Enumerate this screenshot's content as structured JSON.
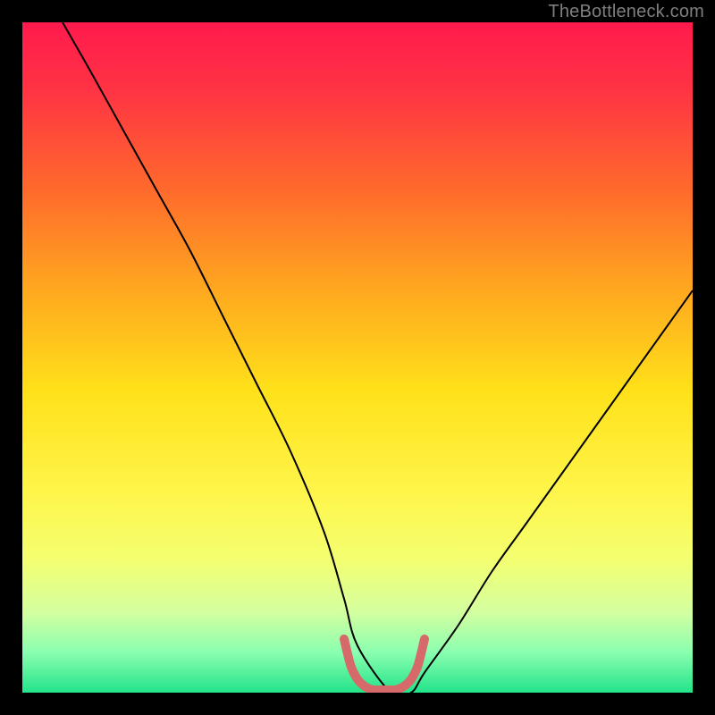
{
  "attribution": "TheBottleneck.com",
  "chart_data": {
    "type": "line",
    "title": "",
    "xlabel": "",
    "ylabel": "",
    "xlim": [
      0,
      100
    ],
    "ylim": [
      0,
      100
    ],
    "grid": false,
    "legend": false,
    "background_gradient_stops": [
      {
        "offset": 0.0,
        "color": "#ff1a4d"
      },
      {
        "offset": 0.1,
        "color": "#ff3344"
      },
      {
        "offset": 0.25,
        "color": "#ff6a2c"
      },
      {
        "offset": 0.4,
        "color": "#ffa81f"
      },
      {
        "offset": 0.55,
        "color": "#ffe11a"
      },
      {
        "offset": 0.7,
        "color": "#fff54a"
      },
      {
        "offset": 0.8,
        "color": "#f4ff70"
      },
      {
        "offset": 0.88,
        "color": "#d4ffa0"
      },
      {
        "offset": 0.94,
        "color": "#8affb0"
      },
      {
        "offset": 1.0,
        "color": "#22e38a"
      }
    ],
    "series": [
      {
        "name": "bottleneck-curve",
        "color": "#000000",
        "stroke_width": 2,
        "x": [
          6,
          10,
          15,
          20,
          25,
          30,
          35,
          40,
          45,
          48,
          50,
          55,
          58,
          60,
          65,
          70,
          75,
          80,
          85,
          90,
          95,
          100
        ],
        "values": [
          100,
          93,
          84,
          75,
          66,
          56,
          46,
          36,
          24,
          14,
          7,
          0,
          0,
          3,
          10,
          18,
          25,
          32,
          39,
          46,
          53,
          60
        ]
      },
      {
        "name": "optimal-range-marker",
        "color": "#d66a6a",
        "stroke_width": 10,
        "stroke_linecap": "round",
        "x": [
          48,
          49,
          50,
          51,
          52,
          53,
          54,
          55,
          56,
          57,
          58,
          59,
          60
        ],
        "values": [
          8,
          4,
          2,
          1,
          0.5,
          0.4,
          0.4,
          0.4,
          0.5,
          1,
          2,
          4,
          8
        ]
      }
    ],
    "annotations": []
  }
}
